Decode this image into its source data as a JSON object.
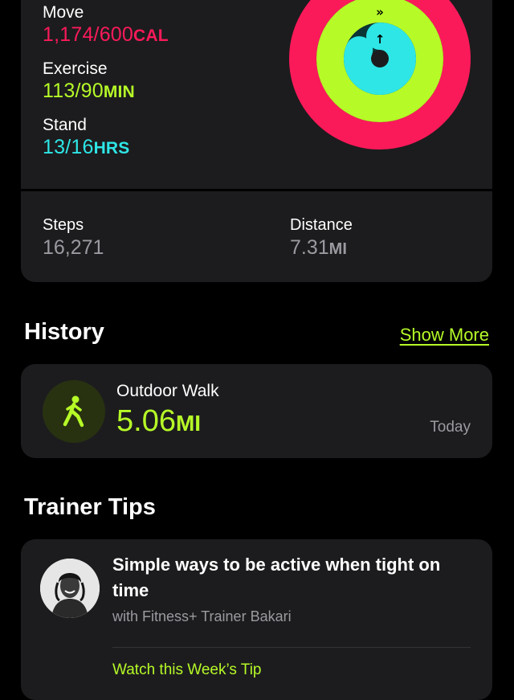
{
  "activity": {
    "move": {
      "label": "Move",
      "value": "1,174/600",
      "unit": "CAL",
      "progress": 1.957
    },
    "exercise": {
      "label": "Exercise",
      "value": "113/90",
      "unit": "MIN",
      "progress": 1.256
    },
    "stand": {
      "label": "Stand",
      "value": "13/16",
      "unit": "HRS",
      "progress": 0.8125
    }
  },
  "stats": {
    "steps": {
      "label": "Steps",
      "value": "16,271"
    },
    "distance": {
      "label": "Distance",
      "value": "7.31",
      "unit": "MI"
    }
  },
  "history": {
    "title": "History",
    "show_more": "Show More",
    "item": {
      "name": "Outdoor Walk",
      "value": "5.06",
      "unit": "MI",
      "date": "Today",
      "icon": "walking-figure-icon"
    }
  },
  "tips": {
    "title": "Trainer Tips",
    "tip_title": "Simple ways to be active when tight on time",
    "subtitle": "with Fitness+ Trainer Bakari",
    "link": "Watch this Week’s Tip"
  },
  "colors": {
    "move": "#fa1a5a",
    "exercise": "#b6fa27",
    "stand": "#2ee6e6",
    "card": "#1c1c1e"
  }
}
